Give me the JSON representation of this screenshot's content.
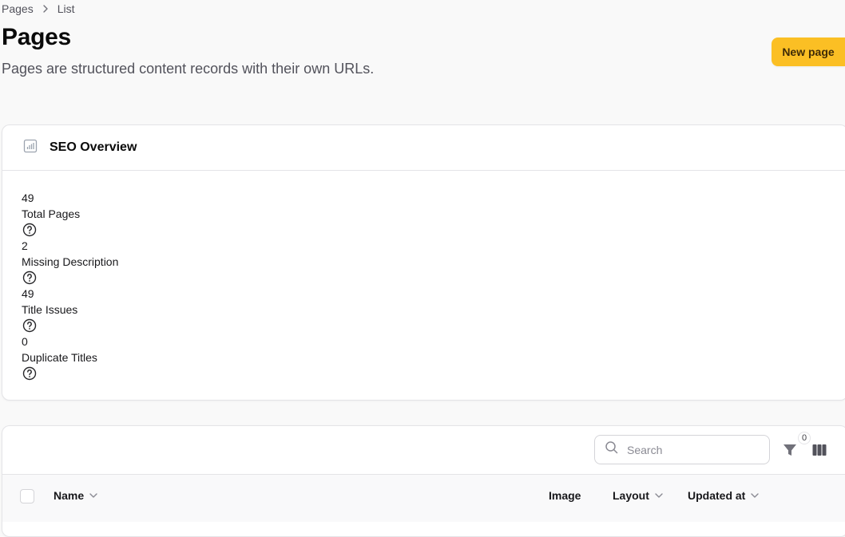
{
  "breadcrumb": {
    "items": [
      "Pages",
      "List"
    ]
  },
  "header": {
    "title": "Pages",
    "description": "Pages are structured content records with their own URLs.",
    "new_button": "New page"
  },
  "seo": {
    "title": "SEO Overview",
    "stats": [
      {
        "value": "49",
        "label": "Total Pages"
      },
      {
        "value": "2",
        "label": "Missing Description"
      },
      {
        "value": "49",
        "label": "Title Issues"
      },
      {
        "value": "0",
        "label": "Duplicate Titles"
      }
    ]
  },
  "table": {
    "search_placeholder": "Search",
    "filter_count": "0",
    "columns": [
      "Name",
      "Image",
      "Layout",
      "Updated at"
    ]
  },
  "colors": {
    "accent": "#fbbf24",
    "background": "#f9f9f9",
    "border": "#e4e4e7"
  },
  "icons": [
    "chevron-right-icon",
    "chart-icon",
    "help-circle-icon",
    "search-icon",
    "filter-icon",
    "columns-icon",
    "chevron-down-icon"
  ]
}
